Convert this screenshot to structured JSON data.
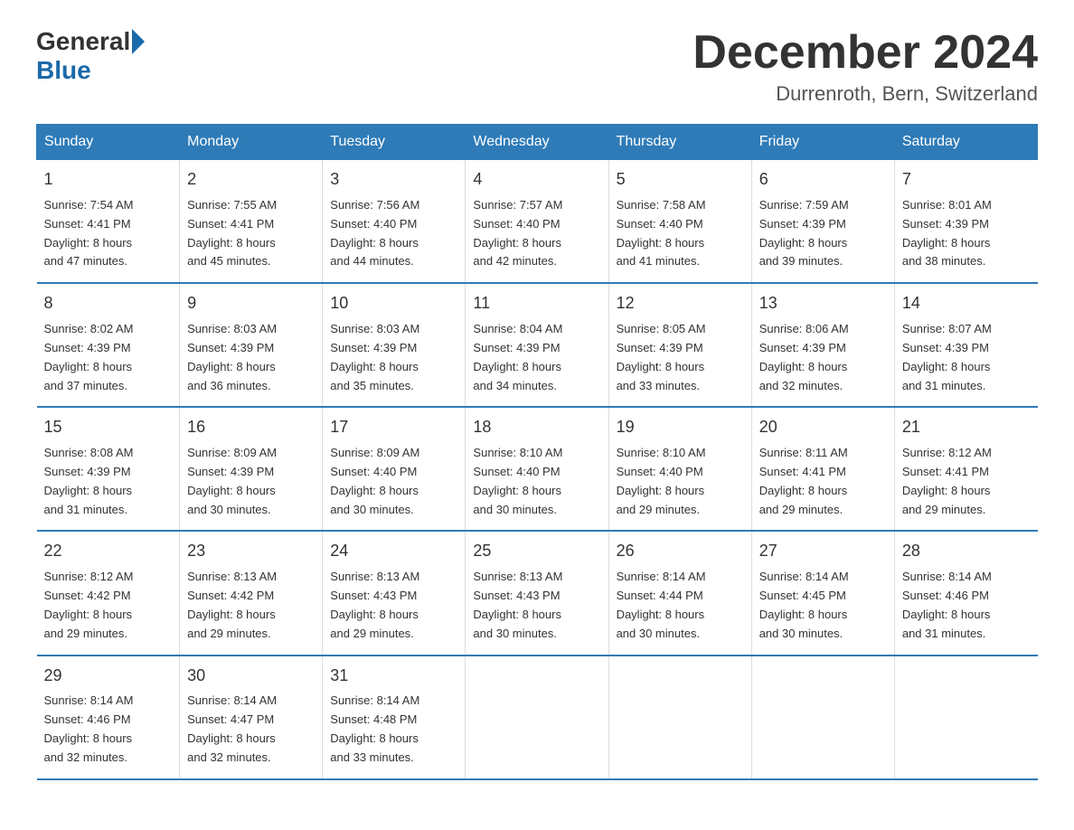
{
  "header": {
    "logo_general": "General",
    "logo_blue": "Blue",
    "month_title": "December 2024",
    "location": "Durrenroth, Bern, Switzerland"
  },
  "days_of_week": [
    "Sunday",
    "Monday",
    "Tuesday",
    "Wednesday",
    "Thursday",
    "Friday",
    "Saturday"
  ],
  "weeks": [
    {
      "days": [
        {
          "num": "1",
          "sunrise": "7:54 AM",
          "sunset": "4:41 PM",
          "daylight": "8 hours and 47 minutes."
        },
        {
          "num": "2",
          "sunrise": "7:55 AM",
          "sunset": "4:41 PM",
          "daylight": "8 hours and 45 minutes."
        },
        {
          "num": "3",
          "sunrise": "7:56 AM",
          "sunset": "4:40 PM",
          "daylight": "8 hours and 44 minutes."
        },
        {
          "num": "4",
          "sunrise": "7:57 AM",
          "sunset": "4:40 PM",
          "daylight": "8 hours and 42 minutes."
        },
        {
          "num": "5",
          "sunrise": "7:58 AM",
          "sunset": "4:40 PM",
          "daylight": "8 hours and 41 minutes."
        },
        {
          "num": "6",
          "sunrise": "7:59 AM",
          "sunset": "4:39 PM",
          "daylight": "8 hours and 39 minutes."
        },
        {
          "num": "7",
          "sunrise": "8:01 AM",
          "sunset": "4:39 PM",
          "daylight": "8 hours and 38 minutes."
        }
      ]
    },
    {
      "days": [
        {
          "num": "8",
          "sunrise": "8:02 AM",
          "sunset": "4:39 PM",
          "daylight": "8 hours and 37 minutes."
        },
        {
          "num": "9",
          "sunrise": "8:03 AM",
          "sunset": "4:39 PM",
          "daylight": "8 hours and 36 minutes."
        },
        {
          "num": "10",
          "sunrise": "8:03 AM",
          "sunset": "4:39 PM",
          "daylight": "8 hours and 35 minutes."
        },
        {
          "num": "11",
          "sunrise": "8:04 AM",
          "sunset": "4:39 PM",
          "daylight": "8 hours and 34 minutes."
        },
        {
          "num": "12",
          "sunrise": "8:05 AM",
          "sunset": "4:39 PM",
          "daylight": "8 hours and 33 minutes."
        },
        {
          "num": "13",
          "sunrise": "8:06 AM",
          "sunset": "4:39 PM",
          "daylight": "8 hours and 32 minutes."
        },
        {
          "num": "14",
          "sunrise": "8:07 AM",
          "sunset": "4:39 PM",
          "daylight": "8 hours and 31 minutes."
        }
      ]
    },
    {
      "days": [
        {
          "num": "15",
          "sunrise": "8:08 AM",
          "sunset": "4:39 PM",
          "daylight": "8 hours and 31 minutes."
        },
        {
          "num": "16",
          "sunrise": "8:09 AM",
          "sunset": "4:39 PM",
          "daylight": "8 hours and 30 minutes."
        },
        {
          "num": "17",
          "sunrise": "8:09 AM",
          "sunset": "4:40 PM",
          "daylight": "8 hours and 30 minutes."
        },
        {
          "num": "18",
          "sunrise": "8:10 AM",
          "sunset": "4:40 PM",
          "daylight": "8 hours and 30 minutes."
        },
        {
          "num": "19",
          "sunrise": "8:10 AM",
          "sunset": "4:40 PM",
          "daylight": "8 hours and 29 minutes."
        },
        {
          "num": "20",
          "sunrise": "8:11 AM",
          "sunset": "4:41 PM",
          "daylight": "8 hours and 29 minutes."
        },
        {
          "num": "21",
          "sunrise": "8:12 AM",
          "sunset": "4:41 PM",
          "daylight": "8 hours and 29 minutes."
        }
      ]
    },
    {
      "days": [
        {
          "num": "22",
          "sunrise": "8:12 AM",
          "sunset": "4:42 PM",
          "daylight": "8 hours and 29 minutes."
        },
        {
          "num": "23",
          "sunrise": "8:13 AM",
          "sunset": "4:42 PM",
          "daylight": "8 hours and 29 minutes."
        },
        {
          "num": "24",
          "sunrise": "8:13 AM",
          "sunset": "4:43 PM",
          "daylight": "8 hours and 29 minutes."
        },
        {
          "num": "25",
          "sunrise": "8:13 AM",
          "sunset": "4:43 PM",
          "daylight": "8 hours and 30 minutes."
        },
        {
          "num": "26",
          "sunrise": "8:14 AM",
          "sunset": "4:44 PM",
          "daylight": "8 hours and 30 minutes."
        },
        {
          "num": "27",
          "sunrise": "8:14 AM",
          "sunset": "4:45 PM",
          "daylight": "8 hours and 30 minutes."
        },
        {
          "num": "28",
          "sunrise": "8:14 AM",
          "sunset": "4:46 PM",
          "daylight": "8 hours and 31 minutes."
        }
      ]
    },
    {
      "days": [
        {
          "num": "29",
          "sunrise": "8:14 AM",
          "sunset": "4:46 PM",
          "daylight": "8 hours and 32 minutes."
        },
        {
          "num": "30",
          "sunrise": "8:14 AM",
          "sunset": "4:47 PM",
          "daylight": "8 hours and 32 minutes."
        },
        {
          "num": "31",
          "sunrise": "8:14 AM",
          "sunset": "4:48 PM",
          "daylight": "8 hours and 33 minutes."
        },
        {
          "num": "",
          "sunrise": "",
          "sunset": "",
          "daylight": ""
        },
        {
          "num": "",
          "sunrise": "",
          "sunset": "",
          "daylight": ""
        },
        {
          "num": "",
          "sunrise": "",
          "sunset": "",
          "daylight": ""
        },
        {
          "num": "",
          "sunrise": "",
          "sunset": "",
          "daylight": ""
        }
      ]
    }
  ],
  "labels": {
    "sunrise": "Sunrise:",
    "sunset": "Sunset:",
    "daylight": "Daylight:"
  }
}
